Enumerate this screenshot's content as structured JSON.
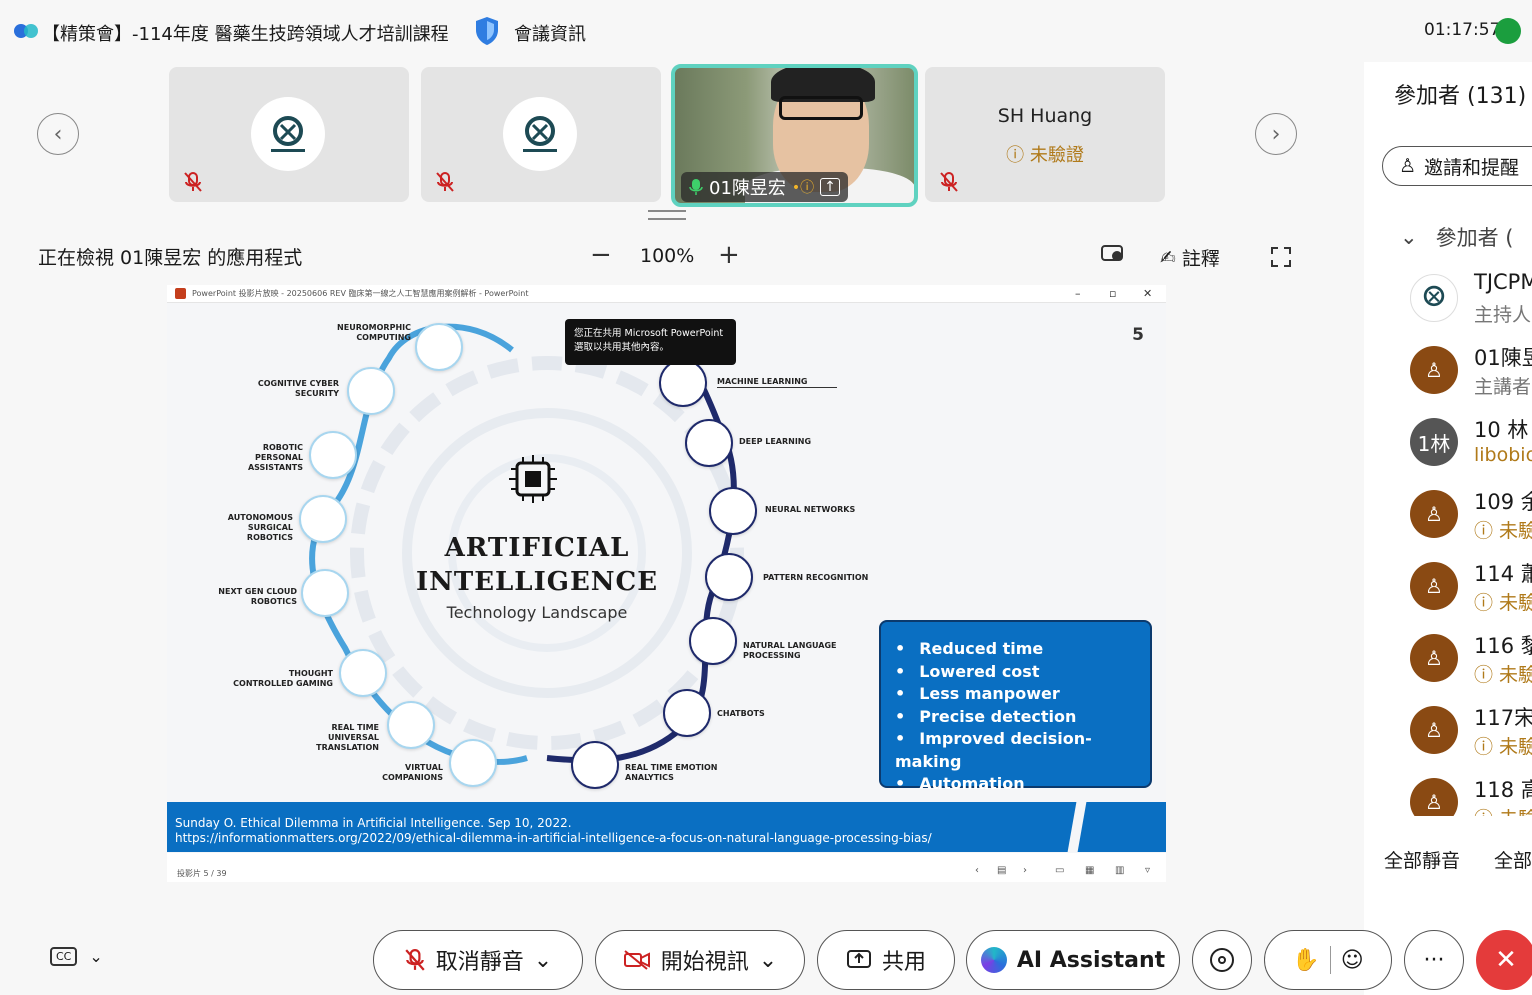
{
  "window": {
    "title": "【精策會】-114年度 醫藥生技跨領域人才培訓課程",
    "meeting_info": "會議資訊",
    "time": "01:17:57"
  },
  "thumbnails": [
    {
      "type": "logo",
      "muted": true
    },
    {
      "type": "logo",
      "muted": true
    },
    {
      "type": "video",
      "name": "01陳昱宏"
    },
    {
      "type": "name",
      "name": "SH Huang",
      "status": "未驗證",
      "muted": true
    }
  ],
  "viewing": {
    "text": "正在檢視 01陳昱宏 的應用程式",
    "zoom": "100%",
    "annotate": "註釋"
  },
  "powerpoint": {
    "titlebar": "PowerPoint 投影片放映 - 20250606 REV 臨床第一線之人工智慧應用案例解析 - PowerPoint",
    "status": "投影片 5 / 39",
    "tooltip_line1": "您正在共用 Microsoft PowerPoint",
    "tooltip_line2": "選取以共用其他內容。"
  },
  "slide": {
    "number": "5",
    "title_line1": "ARTIFICIAL",
    "title_line2": "INTELLIGENCE",
    "subtitle": "Technology Landscape",
    "left_nodes": [
      "NEUROMORPHIC COMPUTING",
      "COGNITIVE CYBER SECURITY",
      "ROBOTIC PERSONAL ASSISTANTS",
      "AUTONOMOUS SURGICAL ROBOTICS",
      "NEXT GEN CLOUD ROBOTICS",
      "THOUGHT CONTROLLED GAMING",
      "REAL TIME UNIVERSAL TRANSLATION",
      "VIRTUAL COMPANIONS"
    ],
    "right_nodes": [
      "MACHINE LEARNING",
      "DEEP LEARNING",
      "NEURAL NETWORKS",
      "PATTERN RECOGNITION",
      "NATURAL LANGUAGE PROCESSING",
      "CHATBOTS",
      "REAL TIME EMOTION ANALYTICS"
    ],
    "benefits": [
      "Reduced time",
      "Lowered cost",
      "Less manpower",
      "Precise detection",
      "Improved decision-making",
      "Automation"
    ],
    "citation_line1": "Sunday O. Ethical Dilemma in Artificial Intelligence. Sep 10, 2022.",
    "citation_line2": "https://informationmatters.org/2022/09/ethical-dilemma-in-artificial-intelligence-a-focus-on-natural-language-processing-bias/"
  },
  "participants": {
    "title": "參加者 (131)",
    "invite": "邀請和提醒",
    "section": "參加者 (",
    "rows": [
      {
        "name": "TJCPM",
        "sub": "主持人",
        "avatar": "logo"
      },
      {
        "name": "01陳昱",
        "sub": "主講者",
        "avatar": "person"
      },
      {
        "name": "10 林",
        "sub": "libobio",
        "avatar": "1林"
      },
      {
        "name": "109 余",
        "sub": "未驗",
        "avatar": "person",
        "warn": true
      },
      {
        "name": "114 蕭",
        "sub": "未驗",
        "avatar": "person",
        "warn": true
      },
      {
        "name": "116 黎",
        "sub": "未驗",
        "avatar": "person",
        "warn": true
      },
      {
        "name": "117宋",
        "sub": "未驗",
        "avatar": "person",
        "warn": true
      },
      {
        "name": "118 高",
        "sub": "未驗",
        "avatar": "person",
        "warn": true
      }
    ],
    "mute_all": "全部靜音",
    "unmute_all": "全部"
  },
  "controls": {
    "unmute": "取消靜音",
    "start_video": "開始視訊",
    "share": "共用",
    "ai": "AI Assistant"
  },
  "colors": {
    "accent": "#5fd2c0",
    "slide_blue": "#0a6fc2",
    "leave_red": "#e43b3b",
    "avatar_brown": "#8a4a13"
  }
}
